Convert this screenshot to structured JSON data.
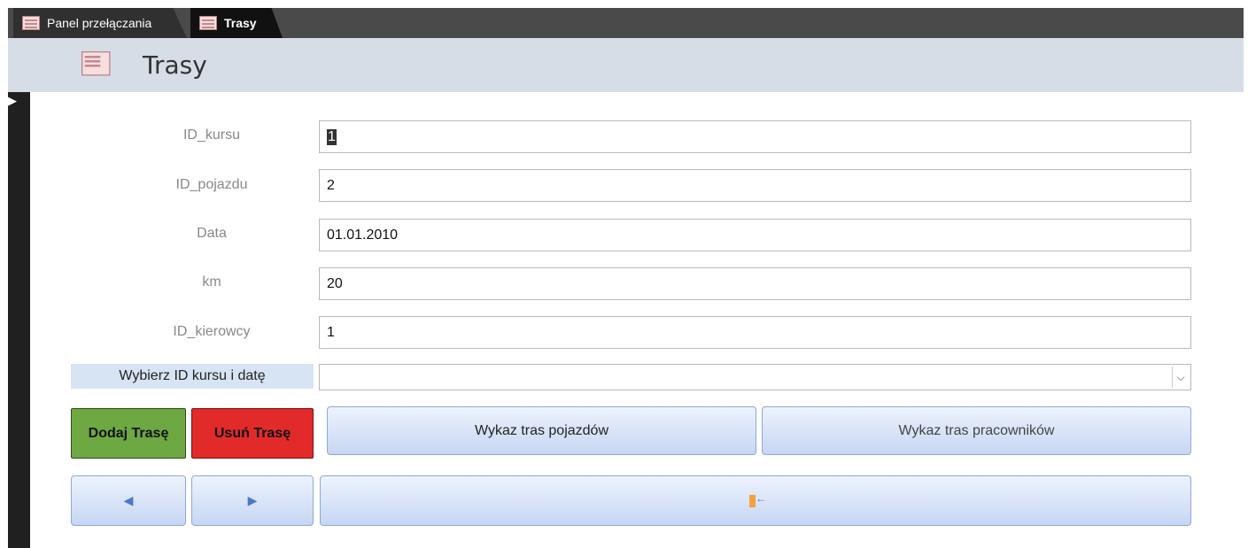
{
  "tabs": [
    {
      "label": "Panel przełączania",
      "icon": "form-icon",
      "active": false
    },
    {
      "label": "Trasy",
      "icon": "form-icon",
      "active": true
    }
  ],
  "header": {
    "title": "Trasy",
    "icon": "form-icon"
  },
  "fields": {
    "id_kursu": {
      "label": "ID_kursu",
      "value": "1"
    },
    "id_pojazdu": {
      "label": "ID_pojazdu",
      "value": "2"
    },
    "data": {
      "label": "Data",
      "value": "01.01.2010"
    },
    "km": {
      "label": "km",
      "value": "20"
    },
    "id_kierowcy": {
      "label": "ID_kierowcy",
      "value": "1"
    }
  },
  "combo": {
    "label": "Wybierz ID kursu i datę",
    "value": ""
  },
  "buttons": {
    "add": "Dodaj Trasę",
    "delete": "Usuń Trasę",
    "vehicle_routes": "Wykaz tras pojazdów",
    "employee_routes": "Wykaz tras pracowników"
  },
  "colors": {
    "add_button": "#6ea842",
    "delete_button": "#e22a2a",
    "header_bg": "#d7dde7",
    "combo_label_bg": "#d7e4f4"
  }
}
